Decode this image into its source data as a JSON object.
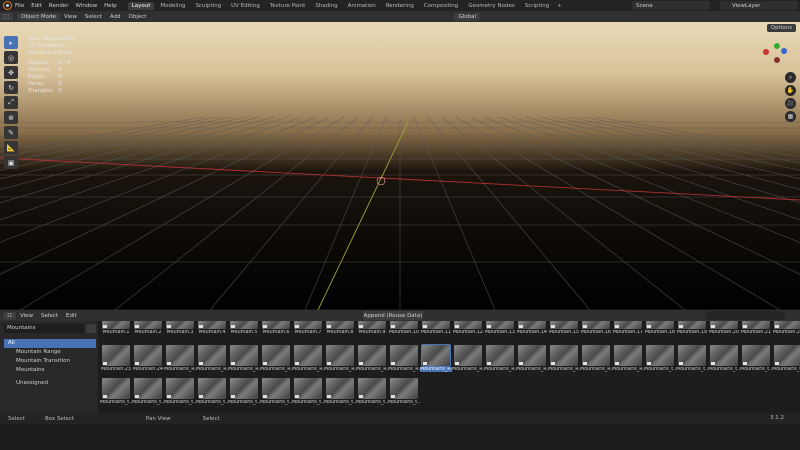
{
  "topbar": {
    "menus": [
      "File",
      "Edit",
      "Render",
      "Window",
      "Help"
    ],
    "workspaces": [
      "Layout",
      "Modeling",
      "Sculpting",
      "UV Editing",
      "Texture Paint",
      "Shading",
      "Animation",
      "Rendering",
      "Compositing",
      "Geometry Nodes",
      "Scripting"
    ],
    "active_workspace": "Layout",
    "scene": "Scene",
    "view_layer": "ViewLayer"
  },
  "viewport_header": {
    "mode": "Object Mode",
    "menus": [
      "View",
      "Select",
      "Add",
      "Object"
    ],
    "transform_orientation": "Global",
    "options": "Options"
  },
  "overlay": {
    "view": "User Perspective",
    "collection": "(1) Collection",
    "render_status": "Rendering Done",
    "stats": [
      {
        "k": "Objects",
        "v": "0 / 0"
      },
      {
        "k": "Vertices",
        "v": "0"
      },
      {
        "k": "Edges",
        "v": "0"
      },
      {
        "k": "Faces",
        "v": "0"
      },
      {
        "k": "Triangles",
        "v": "0"
      }
    ]
  },
  "asset_browser": {
    "menus": [
      "View",
      "Select",
      "Edit"
    ],
    "import_method": "Append (Reuse Data)",
    "library": "Mountains",
    "catalogs": [
      {
        "label": "All",
        "active": true
      },
      {
        "label": "Mountain Range",
        "active": false
      },
      {
        "label": "Mountain Transition",
        "active": false
      },
      {
        "label": "Mountains",
        "active": false
      },
      {
        "label": "Unassigned",
        "active": false
      }
    ],
    "row1": [
      "Mountain.1",
      "Mountain.2",
      "Mountain.3",
      "Mountain.4",
      "Mountain.5",
      "Mountain.6",
      "Mountain.7",
      "Mountain.8",
      "Mountain.9",
      "Mountain.10",
      "Mountain.11",
      "Mountain.12",
      "Mountain.13",
      "Mountain.14",
      "Mountain.15",
      "Mountain.16",
      "Mountain.17",
      "Mountain.18",
      "Mountain.19",
      "Mountain.20",
      "Mountain.21",
      "Mountain.22"
    ],
    "row2": [
      "Mountain.23",
      "Mountain.24",
      "Mountains_R...",
      "Mountains_R...",
      "Mountains_R...",
      "Mountains_R...",
      "Mountains_R...",
      "Mountains_R...",
      "Mountains_R...",
      "Mountains_R...",
      "Mountains_R...",
      "Mountains_R...",
      "Mountains_R...",
      "Mountains_R...",
      "Mountains_R...",
      "Mountains_R...",
      "Mountains_R...",
      "Mountains_t...",
      "Mountains_t...",
      "Mountains_t...",
      "Mountains_t...",
      "Mountains_t..."
    ],
    "row2_selected_index": 10,
    "row3": [
      "Mountains_t...",
      "Mountains_t...",
      "Mountains_t...",
      "Mountains_t...",
      "Mountains_t...",
      "Mountains_t...",
      "Mountains_t...",
      "Mountains_t...",
      "Mountains_t...",
      "Mountains_t..."
    ]
  },
  "status": {
    "items": [
      "Select",
      "Box Select",
      "Pan View",
      "Select"
    ],
    "version": "3.1.2"
  }
}
